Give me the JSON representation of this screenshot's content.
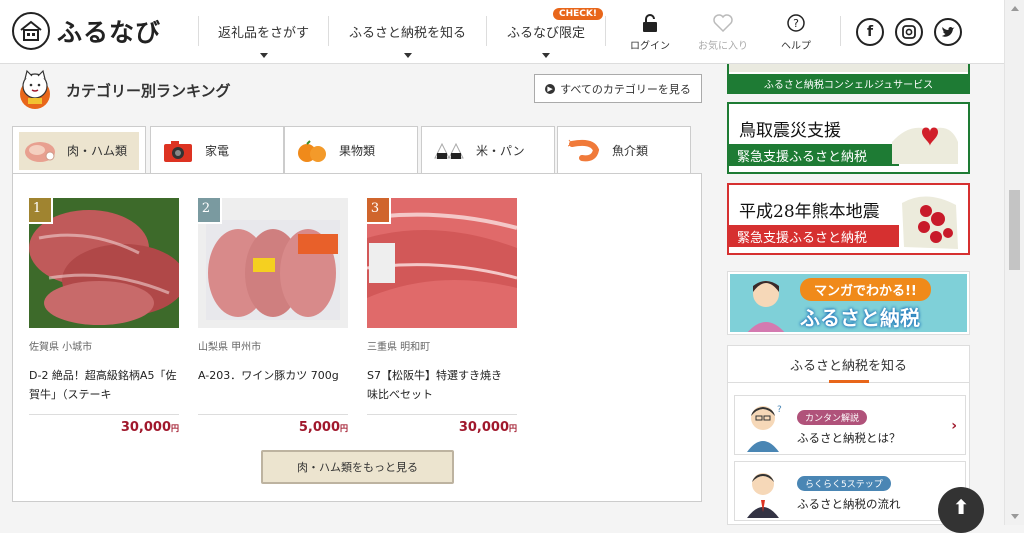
{
  "header": {
    "logo_text": "ふるなび",
    "nav": [
      "返礼品をさがす",
      "ふるさと納税を知る",
      "ふるなび限定"
    ],
    "check_badge": "CHECK!",
    "login_label": "ログイン",
    "favorites_label": "お気に入り",
    "help_label": "ヘルプ",
    "social": [
      "facebook-icon",
      "instagram-icon",
      "twitter-icon"
    ]
  },
  "main": {
    "section_title": "カテゴリー別ランキング",
    "all_categories_label": "すべてのカテゴリーを見る",
    "tabs": [
      {
        "label": "肉・ハム類",
        "icon": "meat-icon",
        "active": true
      },
      {
        "label": "家電",
        "icon": "camera-icon",
        "active": false
      },
      {
        "label": "果物類",
        "icon": "orange-icon",
        "active": false
      },
      {
        "label": "米・パン",
        "icon": "rice-icon",
        "active": false
      },
      {
        "label": "魚介類",
        "icon": "shrimp-icon",
        "active": false
      }
    ],
    "items": [
      {
        "rank": "1",
        "location": "佐賀県 小城市",
        "name": "D-2 絶品！超高級銘柄A5「佐賀牛」（ステーキ",
        "price": "30,000",
        "unit": "円",
        "rank_color": "#a08430"
      },
      {
        "rank": "2",
        "location": "山梨県 甲州市",
        "name": "A-203．ワイン豚カツ 700g",
        "price": "5,000",
        "unit": "円",
        "rank_color": "#7a9aa0"
      },
      {
        "rank": "3",
        "location": "三重県 明和町",
        "name": "S7【松阪牛】特選すき焼き　味比べセット",
        "price": "30,000",
        "unit": "円",
        "rank_color": "#d0652c"
      }
    ],
    "more_label": "肉・ハム類をもっと見る"
  },
  "sidebar": {
    "top_banner_text": "ふるさと納税コンシェルジュサービス",
    "tottori_title": "鳥取震災支援",
    "tottori_sub": "緊急支援ふるさと納税",
    "kumamoto_title": "平成28年熊本地震",
    "kumamoto_sub": "緊急支援ふるさと納税",
    "manga_line1": "マンガでわかる!!",
    "manga_line2": "ふるさと納税",
    "know_title": "ふるさと納税を知る",
    "know_items": [
      {
        "tag": "カンタン解説",
        "text": "ふるさと納税とは？",
        "tag_color": "#b0527a"
      },
      {
        "tag": "らくらく5ステップ",
        "text": "ふるさと納税の流れ",
        "tag_color": "#4a86b4"
      }
    ]
  },
  "colors": {
    "accent": "#e8661a",
    "price": "#a0182c",
    "green": "#1e7b34",
    "red": "#d63030"
  }
}
